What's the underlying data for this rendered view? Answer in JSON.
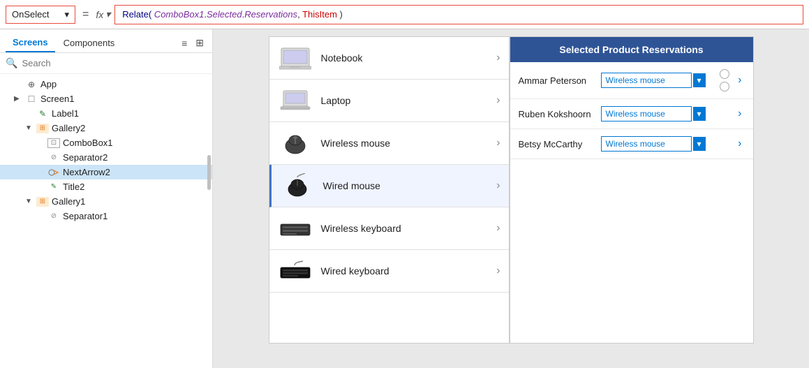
{
  "formulaBar": {
    "property": "OnSelect",
    "chevron": "▾",
    "equals": "=",
    "fxLabel": "fx",
    "fxChevron": "▾",
    "formula": "Relate( ComboBox1.Selected.Reservations, ThisItem )",
    "formulaParts": {
      "fn": "Relate(",
      "obj": " ComboBox1",
      "dot1": ".",
      "prop1": "Selected",
      "dot2": ".",
      "prop2": "Reservations",
      "comma": ", ",
      "keyword": "ThisItem",
      "close": " )"
    }
  },
  "leftPanel": {
    "tabs": [
      "Screens",
      "Components"
    ],
    "activeTab": "Screens",
    "icons": [
      "≡",
      "⊞"
    ],
    "search": {
      "placeholder": "Search"
    },
    "tree": [
      {
        "id": "app",
        "label": "App",
        "icon": "app",
        "indent": 1,
        "arrow": ""
      },
      {
        "id": "screen1",
        "label": "Screen1",
        "indent": 1,
        "icon": "screen",
        "arrow": "▶"
      },
      {
        "id": "label1",
        "label": "Label1",
        "indent": 2,
        "icon": "label",
        "arrow": ""
      },
      {
        "id": "gallery2",
        "label": "Gallery2",
        "indent": 2,
        "icon": "gallery",
        "arrow": "▼"
      },
      {
        "id": "combobox1",
        "label": "ComboBox1",
        "indent": 3,
        "icon": "combo",
        "arrow": ""
      },
      {
        "id": "separator2",
        "label": "Separator2",
        "indent": 3,
        "icon": "sep",
        "arrow": ""
      },
      {
        "id": "nextarrow2",
        "label": "NextArrow2",
        "indent": 3,
        "icon": "arrow",
        "arrow": "",
        "selected": true
      },
      {
        "id": "title2",
        "label": "Title2",
        "indent": 3,
        "icon": "title",
        "arrow": ""
      },
      {
        "id": "gallery1",
        "label": "Gallery1",
        "indent": 2,
        "icon": "gallery",
        "arrow": "▼"
      },
      {
        "id": "separator1",
        "label": "Separator1",
        "indent": 3,
        "icon": "sep",
        "arrow": ""
      }
    ]
  },
  "canvas": {
    "productGallery": {
      "items": [
        {
          "id": "notebook",
          "label": "Notebook",
          "icon": "🖥️"
        },
        {
          "id": "laptop",
          "label": "Laptop",
          "icon": "💻"
        },
        {
          "id": "wireless-mouse",
          "label": "Wireless mouse",
          "icon": "🖱️"
        },
        {
          "id": "wired-mouse",
          "label": "Wired mouse",
          "icon": "🖱️",
          "active": true
        },
        {
          "id": "wireless-keyboard",
          "label": "Wireless keyboard",
          "icon": "⌨️"
        },
        {
          "id": "wired-keyboard",
          "label": "Wired keyboard",
          "icon": "⌨️"
        }
      ]
    },
    "reservations": {
      "header": "Selected Product Reservations",
      "rows": [
        {
          "name": "Ammar Peterson",
          "comboValue": "Wireless mouse"
        },
        {
          "name": "Ruben Kokshoorn",
          "comboValue": "Wireless mouse"
        },
        {
          "name": "Betsy McCarthy",
          "comboValue": "Wireless mouse"
        }
      ]
    }
  }
}
